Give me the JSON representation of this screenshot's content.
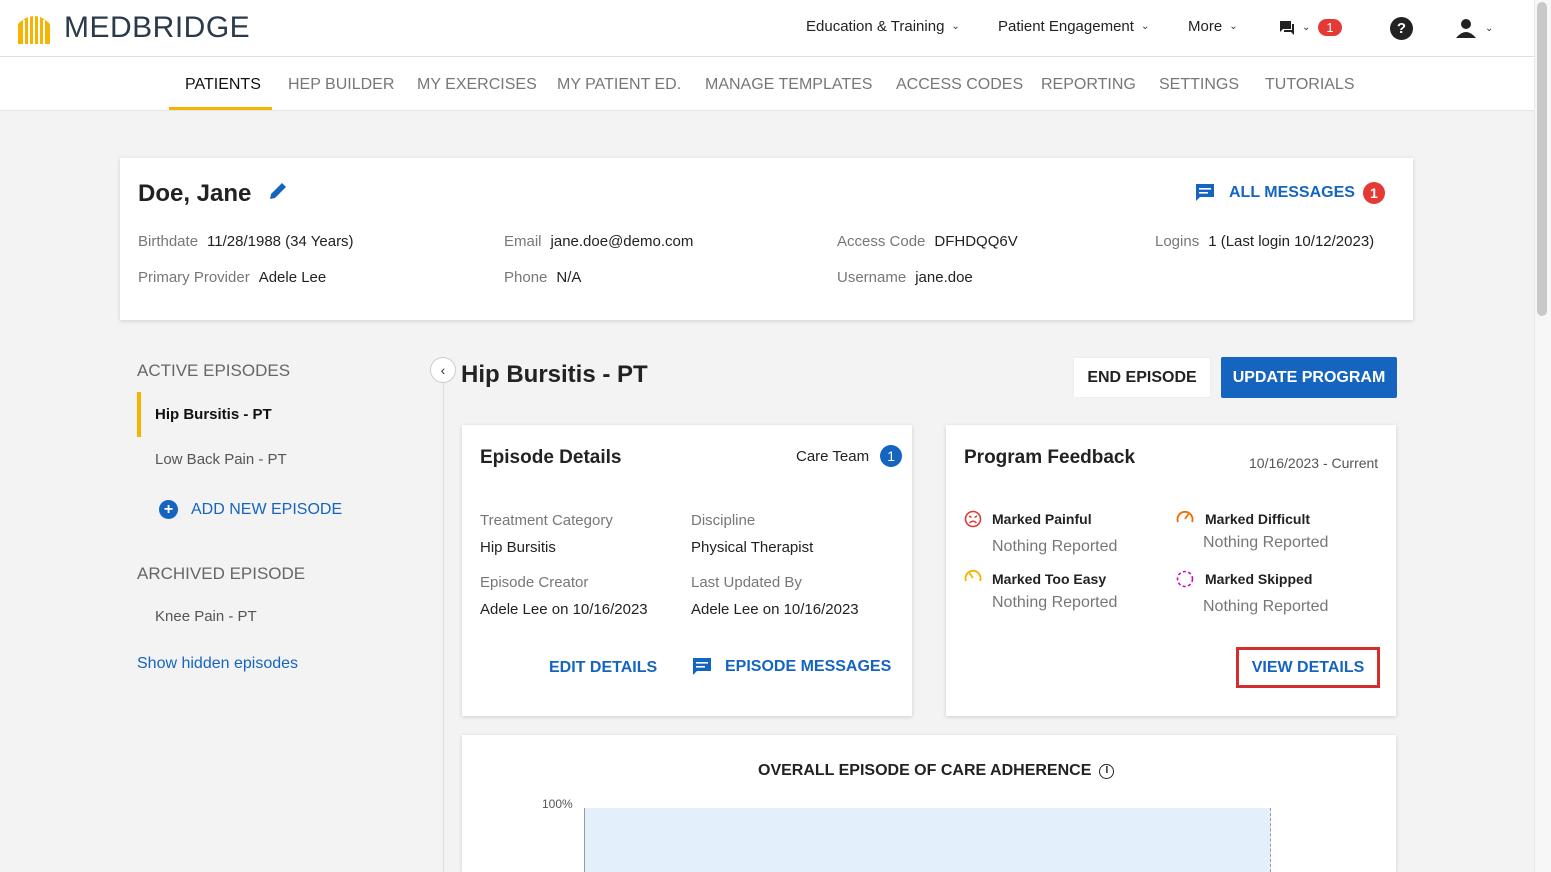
{
  "header": {
    "logo_text": "MEDBRIDGE",
    "nav": [
      "Education & Training",
      "Patient Engagement",
      "More"
    ],
    "message_count": "1",
    "help_glyph": "?"
  },
  "tabs": [
    "PATIENTS",
    "HEP BUILDER",
    "MY EXERCISES",
    "MY PATIENT ED.",
    "MANAGE TEMPLATES",
    "ACCESS CODES",
    "REPORTING",
    "SETTINGS",
    "TUTORIALS"
  ],
  "patient": {
    "name": "Doe, Jane",
    "all_messages_label": "ALL MESSAGES",
    "all_messages_count": "1",
    "birthdate_label": "Birthdate",
    "birthdate": "11/28/1988 (34 Years)",
    "email_label": "Email",
    "email": "jane.doe@demo.com",
    "access_code_label": "Access Code",
    "access_code": "DFHDQQ6V",
    "logins_label": "Logins",
    "logins": "1 (Last login 10/12/2023)",
    "provider_label": "Primary Provider",
    "provider": "Adele Lee",
    "phone_label": "Phone",
    "phone": "N/A",
    "username_label": "Username",
    "username": "jane.doe"
  },
  "sidebar": {
    "active_heading": "ACTIVE EPISODES",
    "active_episodes": [
      "Hip Bursitis - PT",
      "Low Back Pain - PT"
    ],
    "add_episode": "ADD NEW EPISODE",
    "archived_heading": "ARCHIVED EPISODE",
    "archived_episodes": [
      "Knee Pain - PT"
    ],
    "show_hidden": "Show hidden episodes"
  },
  "episode": {
    "title": "Hip Bursitis - PT",
    "end_button": "END EPISODE",
    "update_button": "UPDATE PROGRAM"
  },
  "details": {
    "title": "Episode Details",
    "care_team_label": "Care Team",
    "care_team_count": "1",
    "treatment_category_label": "Treatment Category",
    "treatment_category": "Hip Bursitis",
    "discipline_label": "Discipline",
    "discipline": "Physical Therapist",
    "creator_label": "Episode Creator",
    "creator": "Adele Lee on 10/16/2023",
    "updated_label": "Last Updated By",
    "updated": "Adele Lee on 10/16/2023",
    "edit_button": "EDIT DETAILS",
    "messages_button": "EPISODE MESSAGES"
  },
  "feedback": {
    "title": "Program Feedback",
    "date_range": "10/16/2023 - Current",
    "painful_label": "Marked Painful",
    "painful_value": "Nothing Reported",
    "difficult_label": "Marked Difficult",
    "difficult_value": "Nothing Reported",
    "easy_label": "Marked Too Easy",
    "easy_value": "Nothing Reported",
    "skipped_label": "Marked Skipped",
    "skipped_value": "Nothing Reported",
    "view_details": "VIEW DETAILS"
  },
  "adherence": {
    "title": "OVERALL EPISODE OF CARE ADHERENCE",
    "y_top_label": "100%"
  },
  "colors": {
    "accent_blue": "#1565c0",
    "brand_yellow": "#f5b400",
    "alert_red": "#e53935",
    "highlight_box": "#d32f2f"
  }
}
